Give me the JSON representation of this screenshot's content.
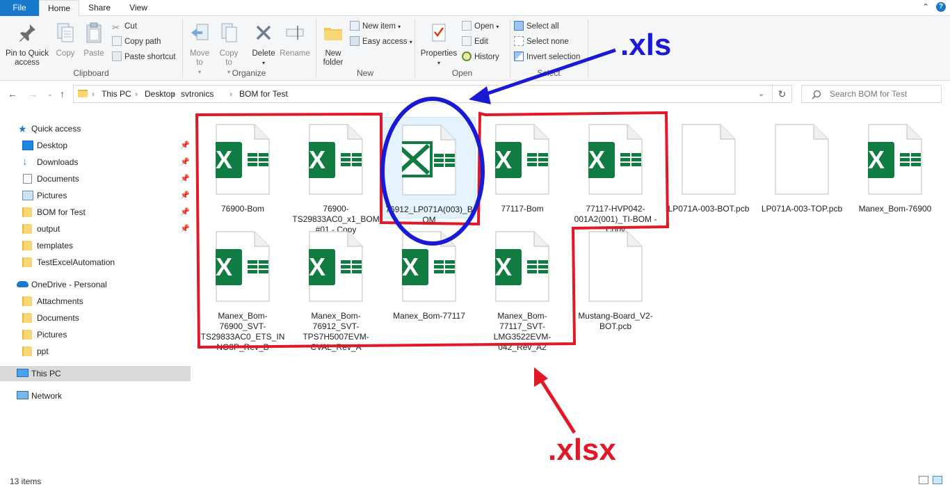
{
  "ribbon_tabs": {
    "file": "File",
    "home": "Home",
    "share": "Share",
    "view": "View"
  },
  "clipboard": {
    "group": "Clipboard",
    "pin": "Pin to Quick access",
    "copy": "Copy",
    "paste": "Paste",
    "cut": "Cut",
    "copy_path": "Copy path",
    "paste_shortcut": "Paste shortcut"
  },
  "organize": {
    "group": "Organize",
    "move_to": "Move to",
    "copy_to": "Copy to",
    "delete": "Delete",
    "rename": "Rename"
  },
  "new": {
    "group": "New",
    "new_folder": "New folder",
    "new_item": "New item",
    "easy_access": "Easy access"
  },
  "open": {
    "group": "Open",
    "properties": "Properties",
    "open": "Open",
    "edit": "Edit",
    "history": "History"
  },
  "select": {
    "group": "Select",
    "select_all": "Select all",
    "select_none": "Select none",
    "invert": "Invert selection"
  },
  "address": {
    "crumbs": [
      "This PC",
      "Desktop",
      "svtronics",
      "BOM for Test"
    ],
    "search_placeholder": "Search BOM for Test"
  },
  "nav": {
    "quick_access": "Quick access",
    "qa_items": [
      "Desktop",
      "Downloads",
      "Documents",
      "Pictures",
      "BOM for Test",
      "output",
      "templates",
      "TestExcelAutomation"
    ],
    "onedrive": "OneDrive - Personal",
    "od_items": [
      "Attachments",
      "Documents",
      "Pictures",
      "ppt"
    ],
    "this_pc": "This PC",
    "network": "Network"
  },
  "files": [
    {
      "name": "76900-Bom",
      "type": "excel"
    },
    {
      "name": "76900-TS29833AC0_x1_BOM#01 - Copy",
      "type": "excel"
    },
    {
      "name": "76912_LP071A(003)_BOM",
      "type": "excel-xls"
    },
    {
      "name": "77117-Bom",
      "type": "excel"
    },
    {
      "name": "77117-HVP042-001A2(001)_TI-BOM - Copy",
      "type": "excel"
    },
    {
      "name": "LP071A-003-BOT.pcb",
      "type": "blank"
    },
    {
      "name": "LP071A-003-TOP.pcb",
      "type": "blank"
    },
    {
      "name": "Manex_Bom-76900",
      "type": "excel"
    },
    {
      "name": "Manex_Bom-76900_SVT-TS29833AC0_ETS_INNO3P_Rev_B",
      "type": "excel"
    },
    {
      "name": "Manex_Bom-76912_SVT-TPS7H5007EVM-CVAL_Rev_A",
      "type": "excel"
    },
    {
      "name": "Manex_Bom-77117",
      "type": "excel"
    },
    {
      "name": "Manex_Bom-77117_SVT-LMG3522EVM-042_Rev_A2",
      "type": "excel"
    },
    {
      "name": "Mustang-Board_V2-BOT.pcb",
      "type": "blank"
    }
  ],
  "status": {
    "count": "13 items"
  },
  "annotations": {
    "xls": ".xls",
    "xlsx": ".xlsx"
  },
  "colors": {
    "excel_green": "#107c41",
    "annot_blue": "#1a1ad6",
    "annot_red": "#e01828",
    "file_tab": "#1979ca"
  }
}
